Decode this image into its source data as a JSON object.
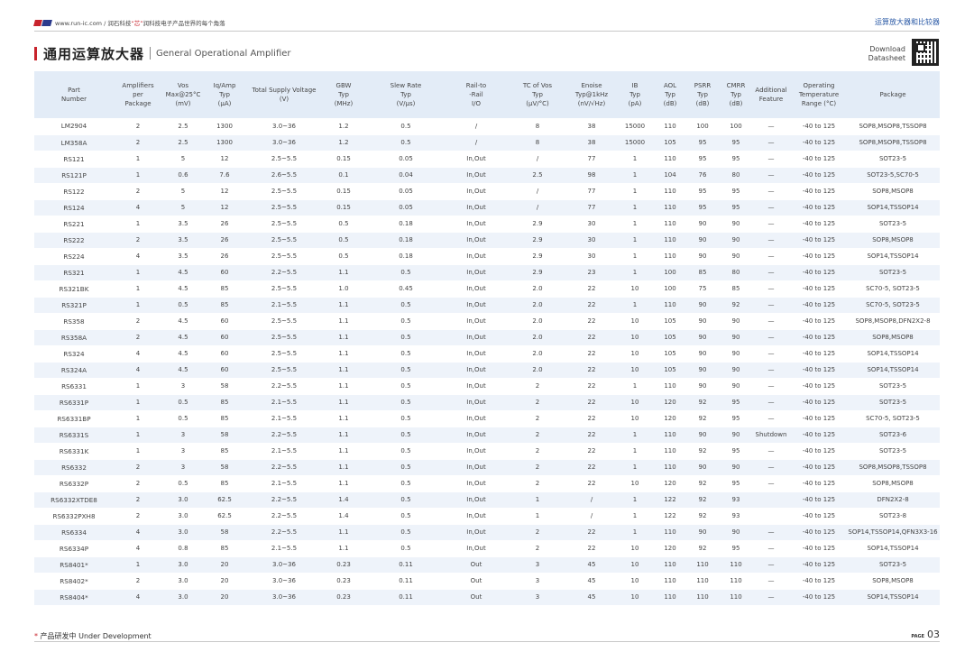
{
  "header": {
    "website": "www.run-ic.com",
    "slash": " / ",
    "brand": "润石科技",
    "slogan_a": "“芯”",
    "slogan_b": "润科技电子产品世界的每个角落",
    "category": "运算放大器和比较器"
  },
  "title": {
    "cn": "通用运算放大器",
    "en": "General Operational Amplifier"
  },
  "download": {
    "line1": "Download",
    "line2": "Datasheet"
  },
  "table": {
    "columns": [
      [
        "Part",
        "Number"
      ],
      [
        "Amplifiers",
        "per",
        "Package"
      ],
      [
        "Vos",
        "Max@25°C",
        "(mV)"
      ],
      [
        "Iq/Amp",
        "Typ",
        "(µA)"
      ],
      [
        "Total Supply Voltage",
        "(V)"
      ],
      [
        "GBW",
        "Typ",
        "(MHz)"
      ],
      [
        "Slew Rate",
        "Typ",
        "(V/µs)"
      ],
      [
        "Rail-to",
        "-Rail",
        "I/O"
      ],
      [
        "TC of Vos",
        "Typ",
        "(µV/°C)"
      ],
      [
        "Enoise",
        "Typ@1kHz",
        "(nV/√Hz)"
      ],
      [
        "IB",
        "Typ",
        "(pA)"
      ],
      [
        "AOL",
        "Typ",
        "(dB)"
      ],
      [
        "PSRR",
        "Typ",
        "(dB)"
      ],
      [
        "CMRR",
        "Typ",
        "(dB)"
      ],
      [
        "Additional",
        "Feature"
      ],
      [
        "Operating",
        "Temperature",
        "Range (°C)"
      ],
      [
        "Package"
      ]
    ],
    "rows": [
      [
        "LM2904",
        "2",
        "2.5",
        "1300",
        "3.0~36",
        "1.2",
        "0.5",
        "/",
        "8",
        "38",
        "15000",
        "110",
        "100",
        "100",
        "—",
        "-40 to 125",
        "SOP8,MSOP8,TSSOP8"
      ],
      [
        "LM358A",
        "2",
        "2.5",
        "1300",
        "3.0~36",
        "1.2",
        "0.5",
        "/",
        "8",
        "38",
        "15000",
        "105",
        "95",
        "95",
        "—",
        "-40 to 125",
        "SOP8,MSOP8,TSSOP8"
      ],
      [
        "RS121",
        "1",
        "5",
        "12",
        "2.5~5.5",
        "0.15",
        "0.05",
        "In,Out",
        "/",
        "77",
        "1",
        "110",
        "95",
        "95",
        "—",
        "-40 to 125",
        "SOT23-5"
      ],
      [
        "RS121P",
        "1",
        "0.6",
        "7.6",
        "2.6~5.5",
        "0.1",
        "0.04",
        "In,Out",
        "2.5",
        "98",
        "1",
        "104",
        "76",
        "80",
        "—",
        "-40 to 125",
        "SOT23-5,SC70-5"
      ],
      [
        "RS122",
        "2",
        "5",
        "12",
        "2.5~5.5",
        "0.15",
        "0.05",
        "In,Out",
        "/",
        "77",
        "1",
        "110",
        "95",
        "95",
        "—",
        "-40 to 125",
        "SOP8,MSOP8"
      ],
      [
        "RS124",
        "4",
        "5",
        "12",
        "2.5~5.5",
        "0.15",
        "0.05",
        "In,Out",
        "/",
        "77",
        "1",
        "110",
        "95",
        "95",
        "—",
        "-40 to 125",
        "SOP14,TSSOP14"
      ],
      [
        "RS221",
        "1",
        "3.5",
        "26",
        "2.5~5.5",
        "0.5",
        "0.18",
        "In,Out",
        "2.9",
        "30",
        "1",
        "110",
        "90",
        "90",
        "—",
        "-40 to 125",
        "SOT23-5"
      ],
      [
        "RS222",
        "2",
        "3.5",
        "26",
        "2.5~5.5",
        "0.5",
        "0.18",
        "In,Out",
        "2.9",
        "30",
        "1",
        "110",
        "90",
        "90",
        "—",
        "-40 to 125",
        "SOP8,MSOP8"
      ],
      [
        "RS224",
        "4",
        "3.5",
        "26",
        "2.5~5.5",
        "0.5",
        "0.18",
        "In,Out",
        "2.9",
        "30",
        "1",
        "110",
        "90",
        "90",
        "—",
        "-40 to 125",
        "SOP14,TSSOP14"
      ],
      [
        "RS321",
        "1",
        "4.5",
        "60",
        "2.2~5.5",
        "1.1",
        "0.5",
        "In,Out",
        "2.9",
        "23",
        "1",
        "100",
        "85",
        "80",
        "—",
        "-40 to 125",
        "SOT23-5"
      ],
      [
        "RS321BK",
        "1",
        "4.5",
        "85",
        "2.5~5.5",
        "1.0",
        "0.45",
        "In,Out",
        "2.0",
        "22",
        "10",
        "100",
        "75",
        "85",
        "—",
        "-40 to 125",
        "SC70-5, SOT23-5"
      ],
      [
        "RS321P",
        "1",
        "0.5",
        "85",
        "2.1~5.5",
        "1.1",
        "0.5",
        "In,Out",
        "2.0",
        "22",
        "1",
        "110",
        "90",
        "92",
        "—",
        "-40 to 125",
        "SC70-5, SOT23-5"
      ],
      [
        "RS358",
        "2",
        "4.5",
        "60",
        "2.5~5.5",
        "1.1",
        "0.5",
        "In,Out",
        "2.0",
        "22",
        "10",
        "105",
        "90",
        "90",
        "—",
        "-40 to 125",
        "SOP8,MSOP8,DFN2X2-8"
      ],
      [
        "RS358A",
        "2",
        "4.5",
        "60",
        "2.5~5.5",
        "1.1",
        "0.5",
        "In,Out",
        "2.0",
        "22",
        "10",
        "105",
        "90",
        "90",
        "—",
        "-40 to 125",
        "SOP8,MSOP8"
      ],
      [
        "RS324",
        "4",
        "4.5",
        "60",
        "2.5~5.5",
        "1.1",
        "0.5",
        "In,Out",
        "2.0",
        "22",
        "10",
        "105",
        "90",
        "90",
        "—",
        "-40 to 125",
        "SOP14,TSSOP14"
      ],
      [
        "RS324A",
        "4",
        "4.5",
        "60",
        "2.5~5.5",
        "1.1",
        "0.5",
        "In,Out",
        "2.0",
        "22",
        "10",
        "105",
        "90",
        "90",
        "—",
        "-40 to 125",
        "SOP14,TSSOP14"
      ],
      [
        "RS6331",
        "1",
        "3",
        "58",
        "2.2~5.5",
        "1.1",
        "0.5",
        "In,Out",
        "2",
        "22",
        "1",
        "110",
        "90",
        "90",
        "—",
        "-40 to 125",
        "SOT23-5"
      ],
      [
        "RS6331P",
        "1",
        "0.5",
        "85",
        "2.1~5.5",
        "1.1",
        "0.5",
        "In,Out",
        "2",
        "22",
        "10",
        "120",
        "92",
        "95",
        "—",
        "-40 to 125",
        "SOT23-5"
      ],
      [
        "RS6331BP",
        "1",
        "0.5",
        "85",
        "2.1~5.5",
        "1.1",
        "0.5",
        "In,Out",
        "2",
        "22",
        "10",
        "120",
        "92",
        "95",
        "—",
        "-40 to 125",
        "SC70-5, SOT23-5"
      ],
      [
        "RS6331S",
        "1",
        "3",
        "58",
        "2.2~5.5",
        "1.1",
        "0.5",
        "In,Out",
        "2",
        "22",
        "1",
        "110",
        "90",
        "90",
        "Shutdown",
        "-40 to 125",
        "SOT23-6"
      ],
      [
        "RS6331K",
        "1",
        "3",
        "85",
        "2.1~5.5",
        "1.1",
        "0.5",
        "In,Out",
        "2",
        "22",
        "1",
        "110",
        "92",
        "95",
        "—",
        "-40 to 125",
        "SOT23-5"
      ],
      [
        "RS6332",
        "2",
        "3",
        "58",
        "2.2~5.5",
        "1.1",
        "0.5",
        "In,Out",
        "2",
        "22",
        "1",
        "110",
        "90",
        "90",
        "—",
        "-40 to 125",
        "SOP8,MSOP8,TSSOP8"
      ],
      [
        "RS6332P",
        "2",
        "0.5",
        "85",
        "2.1~5.5",
        "1.1",
        "0.5",
        "In,Out",
        "2",
        "22",
        "10",
        "120",
        "92",
        "95",
        "—",
        "-40 to 125",
        "SOP8,MSOP8"
      ],
      [
        "RS6332XTDE8",
        "2",
        "3.0",
        "62.5",
        "2.2~5.5",
        "1.4",
        "0.5",
        "In,Out",
        "1",
        "/",
        "1",
        "122",
        "92",
        "93",
        "",
        "-40 to 125",
        "DFN2X2-8"
      ],
      [
        "RS6332PXH8",
        "2",
        "3.0",
        "62.5",
        "2.2~5.5",
        "1.4",
        "0.5",
        "In,Out",
        "1",
        "/",
        "1",
        "122",
        "92",
        "93",
        "",
        "-40 to 125",
        "SOT23-8"
      ],
      [
        "RS6334",
        "4",
        "3.0",
        "58",
        "2.2~5.5",
        "1.1",
        "0.5",
        "In,Out",
        "2",
        "22",
        "1",
        "110",
        "90",
        "90",
        "—",
        "-40 to 125",
        "SOP14,TSSOP14,QFN3X3-16"
      ],
      [
        "RS6334P",
        "4",
        "0.8",
        "85",
        "2.1~5.5",
        "1.1",
        "0.5",
        "In,Out",
        "2",
        "22",
        "10",
        "120",
        "92",
        "95",
        "—",
        "-40 to 125",
        "SOP14,TSSOP14"
      ],
      [
        "RS8401*",
        "1",
        "3.0",
        "20",
        "3.0~36",
        "0.23",
        "0.11",
        "Out",
        "3",
        "45",
        "10",
        "110",
        "110",
        "110",
        "—",
        "-40 to 125",
        "SOT23-5"
      ],
      [
        "RS8402*",
        "2",
        "3.0",
        "20",
        "3.0~36",
        "0.23",
        "0.11",
        "Out",
        "3",
        "45",
        "10",
        "110",
        "110",
        "110",
        "—",
        "-40 to 125",
        "SOP8,MSOP8"
      ],
      [
        "RS8404*",
        "4",
        "3.0",
        "20",
        "3.0~36",
        "0.23",
        "0.11",
        "Out",
        "3",
        "45",
        "10",
        "110",
        "110",
        "110",
        "—",
        "-40 to 125",
        "SOP14,TSSOP14"
      ]
    ]
  },
  "footer": {
    "star": "*",
    "note": " 产品研发中 Under Development",
    "page_label": "PAGE",
    "page_number": "03"
  },
  "colors": {
    "accent_red": "#c8232c",
    "header_blue": "#e3ecf7",
    "stripe_blue": "#eef3fa",
    "category_blue": "#2b5aa6"
  }
}
